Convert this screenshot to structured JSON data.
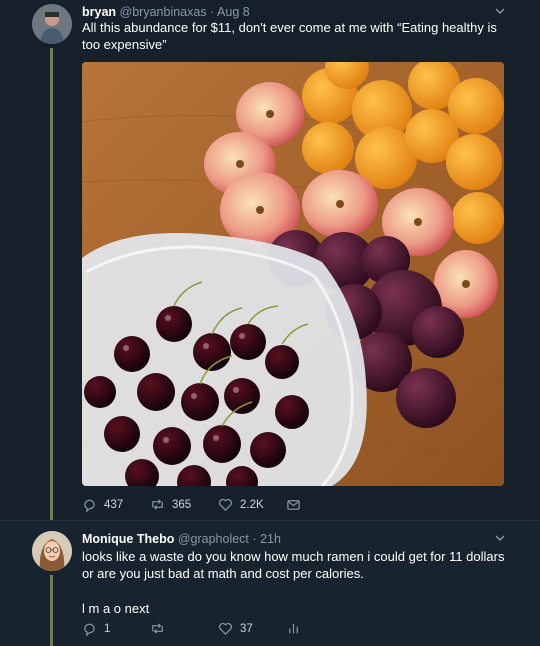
{
  "tweet1": {
    "name": "bryan",
    "handle": "@bryanbinaxas",
    "separator": "·",
    "time": "Aug 8",
    "text": "All this abundance for $11, don't ever come at me with “Eating healthy is too expensive”",
    "reply_count": "437",
    "retweet_count": "365",
    "like_count": "2.2K"
  },
  "tweet2": {
    "name": "Monique Thebo",
    "handle": "@grapholect",
    "separator": "·",
    "time": "21h",
    "text": "looks like a waste do you know how much ramen i could get for 11 dollars or are you just bad at math and cost per calories.",
    "text2": "l m a o next",
    "reply_count": "1",
    "retweet_count": "",
    "like_count": "37"
  },
  "colors": {
    "background": "#15202b",
    "thread_line": "#717f59",
    "meta_text": "#8899a6"
  },
  "icons": {
    "reply": "reply-icon",
    "retweet": "retweet-icon",
    "like": "heart-icon",
    "dm": "envelope-icon",
    "analytics": "analytics-icon",
    "caret": "chevron-down-icon"
  }
}
